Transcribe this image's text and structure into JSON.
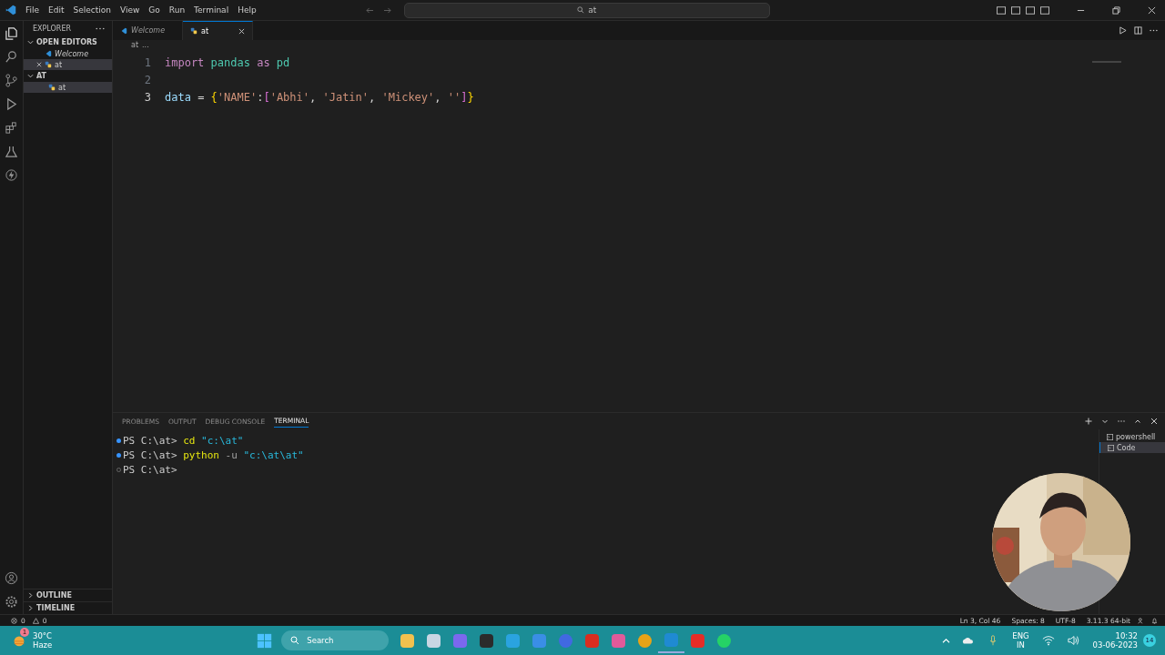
{
  "menu": [
    "File",
    "Edit",
    "Selection",
    "View",
    "Go",
    "Run",
    "Terminal",
    "Help"
  ],
  "command_center": {
    "value": "at"
  },
  "sidebar": {
    "title": "EXPLORER",
    "sections": [
      {
        "label": "OPEN EDITORS",
        "expanded": true,
        "items": [
          {
            "label": "Welcome",
            "kind": "vscode",
            "selected": false,
            "closable": false
          },
          {
            "label": "at",
            "kind": "python",
            "selected": true,
            "closable": true
          }
        ]
      },
      {
        "label": "AT",
        "expanded": true,
        "items": [
          {
            "label": "at",
            "kind": "python",
            "selected": true,
            "closable": false
          }
        ]
      }
    ],
    "collapsed": [
      {
        "label": "OUTLINE",
        "expanded": false
      },
      {
        "label": "TIMELINE",
        "expanded": false
      }
    ]
  },
  "tabs": [
    {
      "label": "Welcome",
      "kind": "vscode",
      "selected": false
    },
    {
      "label": "at",
      "kind": "python",
      "selected": true
    }
  ],
  "breadcrumb": [
    "at",
    "..."
  ],
  "code": [
    {
      "number": "1",
      "tokens": [
        {
          "kind": "keyword",
          "text": "import"
        },
        {
          "kind": "module",
          "text": " pandas"
        },
        {
          "kind": "keyword",
          "text": " as"
        },
        {
          "kind": "alias",
          "text": " pd"
        }
      ]
    },
    {
      "number": "2"
    },
    {
      "number": "3",
      "tokens": [
        {
          "kind": "variable",
          "text": "data"
        },
        {
          "kind": "plain",
          "text": " = "
        },
        {
          "kind": "brace",
          "text": "{"
        },
        {
          "kind": "string",
          "text": "'NAME'"
        },
        {
          "kind": "plain",
          "text": ":"
        },
        {
          "kind": "bracket",
          "text": "["
        },
        {
          "kind": "string",
          "text": "'Abhi'"
        },
        {
          "kind": "plain",
          "text": ", "
        },
        {
          "kind": "string",
          "text": "'Jatin'"
        },
        {
          "kind": "plain",
          "text": ", "
        },
        {
          "kind": "string",
          "text": "'Mickey'"
        },
        {
          "kind": "plain",
          "text": ", "
        },
        {
          "kind": "string",
          "text": "''"
        },
        {
          "kind": "bracket",
          "text": "]"
        },
        {
          "kind": "brace",
          "text": "}"
        }
      ]
    }
  ],
  "panel_tabs": [
    {
      "label": "PROBLEMS",
      "selected": false
    },
    {
      "label": "OUTPUT",
      "selected": false
    },
    {
      "label": "DEBUG CONSOLE",
      "selected": false
    },
    {
      "label": "TERMINAL",
      "selected": true
    }
  ],
  "terminal": [
    {
      "succeeded": true,
      "prompt": "PS C:\\at>",
      "tokens": [
        {
          "kind": "command",
          "text": " cd"
        },
        {
          "kind": "string",
          "text": " \"c:\\at\""
        }
      ]
    },
    {
      "succeeded": true,
      "prompt": "PS C:\\at>",
      "tokens": [
        {
          "kind": "command",
          "text": " python"
        },
        {
          "kind": "flag",
          "text": " -u"
        },
        {
          "kind": "string",
          "text": " \"c:\\at\\at\""
        }
      ]
    },
    {
      "succeeded": false,
      "prompt": "PS C:\\at>"
    }
  ],
  "terminals": [
    {
      "label": "powershell",
      "selected": false
    },
    {
      "label": "Code",
      "selected": true
    }
  ],
  "status_bar": {
    "errors": "0",
    "warnings": "0",
    "items": [
      "Ln 3, Col 46",
      "Spaces: 8",
      "UTF-8",
      "3.11.3 64-bit"
    ]
  },
  "webcam": {
    "kind": "picture"
  },
  "taskbar": {
    "weather": {
      "temp": "30°C",
      "condition": "Haze",
      "badge": "1"
    },
    "search": {
      "placeholder": "Search"
    },
    "apps": [
      {
        "kind": "folder",
        "color": "#f2c14e",
        "active": false
      },
      {
        "kind": "window",
        "color": "#c9d6e3",
        "active": false
      },
      {
        "kind": "video",
        "color": "#7b68ee",
        "active": false
      },
      {
        "kind": "camera",
        "color": "#2b2b2b",
        "active": false
      },
      {
        "kind": "send",
        "color": "#2aa3e0",
        "active": false
      },
      {
        "kind": "store",
        "color": "#3a8ee6",
        "active": false
      },
      {
        "kind": "browser",
        "color": "#4169e1",
        "active": false
      },
      {
        "kind": "pdf",
        "color": "#d92d20",
        "active": false
      },
      {
        "kind": "photos",
        "color": "#e05a9a",
        "active": false
      },
      {
        "kind": "chrome",
        "color": "#e8a317",
        "active": false
      },
      {
        "kind": "code",
        "color": "#1f8ad2",
        "active": true
      },
      {
        "kind": "play",
        "color": "#e52d27",
        "active": false
      },
      {
        "kind": "chat",
        "color": "#25d366",
        "active": false
      }
    ],
    "lang": [
      "ENG",
      "IN"
    ],
    "time": "10:32",
    "date": "03-06-2023",
    "badge": "14"
  }
}
